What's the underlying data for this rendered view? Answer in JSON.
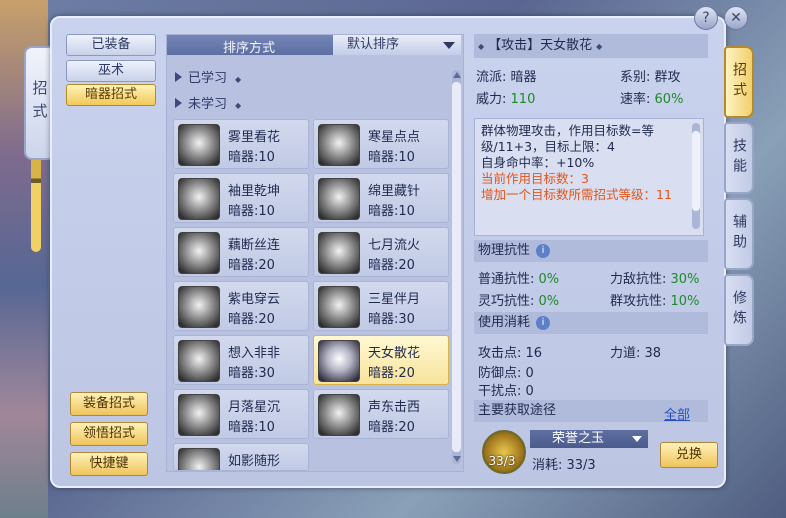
{
  "side_tab": {
    "label": "招式"
  },
  "left_buttons": [
    {
      "label": "已装备",
      "active": false
    },
    {
      "label": "巫术",
      "active": false
    },
    {
      "label": "暗器招式",
      "active": true
    }
  ],
  "action_buttons": [
    {
      "label": "装备招式"
    },
    {
      "label": "领悟招式"
    },
    {
      "label": "快捷键"
    }
  ],
  "list": {
    "sort_label": "排序方式",
    "sort_value": "默认排序",
    "categories": [
      {
        "label": "已学习"
      },
      {
        "label": "未学习"
      }
    ],
    "skills": [
      {
        "name": "雾里看花",
        "level": "暗器:10"
      },
      {
        "name": "寒星点点",
        "level": "暗器:10"
      },
      {
        "name": "袖里乾坤",
        "level": "暗器:10"
      },
      {
        "name": "绵里藏针",
        "level": "暗器:10"
      },
      {
        "name": "藕断丝连",
        "level": "暗器:20"
      },
      {
        "name": "七月流火",
        "level": "暗器:20"
      },
      {
        "name": "紫电穿云",
        "level": "暗器:20"
      },
      {
        "name": "三星伴月",
        "level": "暗器:30"
      },
      {
        "name": "想入非非",
        "level": "暗器:30"
      },
      {
        "name": "天女散花",
        "level": "暗器:20"
      },
      {
        "name": "月落星沉",
        "level": "暗器:10"
      },
      {
        "name": "声东击西",
        "level": "暗器:20"
      },
      {
        "name": "如影随形",
        "level": ""
      }
    ],
    "selected": "天女散花"
  },
  "detail": {
    "title": "【攻击】天女散花",
    "school_label": "流派:",
    "school": "暗器",
    "type_label": "系别:",
    "type": "群攻",
    "power_label": "威力:",
    "power": "110",
    "speed_label": "速率:",
    "speed": "60%",
    "desc_line1": "群体物理攻击，作用目标数=等级/11+3，目标上限：4",
    "desc_line2": "自身命中率：+10%",
    "desc_line3": "当前作用目标数：3",
    "desc_line4": "增加一个目标数所需招式等级：11",
    "resist_title": "物理抗性",
    "resist": [
      {
        "label": "普通抗性:",
        "value": "0%"
      },
      {
        "label": "力敌抗性:",
        "value": "30%"
      },
      {
        "label": "灵巧抗性:",
        "value": "0%"
      },
      {
        "label": "群攻抗性:",
        "value": "10%"
      }
    ],
    "cost_title": "使用消耗",
    "costs": [
      {
        "label": "攻击点:",
        "value": "16"
      },
      {
        "label": "力道:",
        "value": "38"
      },
      {
        "label": "防御点:",
        "value": "0"
      },
      {
        "label": "干扰点:",
        "value": "0"
      }
    ],
    "source_title": "主要获取途径",
    "source_link": "全部",
    "item_count": "33/3",
    "item_name": "荣誉之玉",
    "consume": "消耗: 33/3",
    "exchange": "兑换"
  },
  "vtabs": [
    {
      "label": "招式",
      "active": true
    },
    {
      "label": "技能",
      "active": false
    },
    {
      "label": "辅助",
      "active": false
    },
    {
      "label": "修炼",
      "active": false
    }
  ],
  "top_buttons": {
    "help": "?",
    "close": "✕"
  },
  "colors": {
    "accent_gold": "#f1cf6c",
    "green_value": "#1d8a2a",
    "orange_text": "#e2561a"
  }
}
